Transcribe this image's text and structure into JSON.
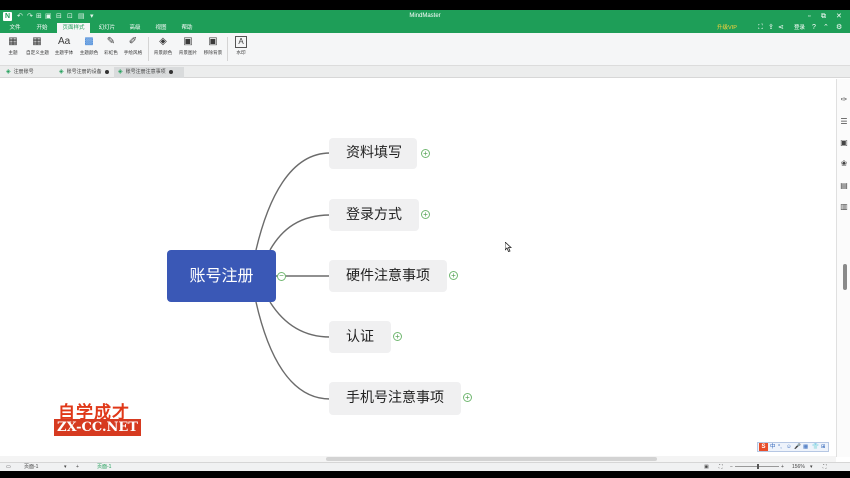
{
  "app": {
    "title": "MindMaster",
    "logo": "N"
  },
  "quick_access": [
    "↶",
    "↷",
    "⊞",
    "▣",
    "⊟",
    "⊡",
    "▤",
    "▾"
  ],
  "window_controls": [
    "▫",
    "⧉",
    "✕"
  ],
  "menu_tabs": [
    {
      "label": "文件"
    },
    {
      "label": "开始"
    },
    {
      "label": "页面样式"
    },
    {
      "label": "幻灯片"
    },
    {
      "label": "高级"
    },
    {
      "label": "视图"
    },
    {
      "label": "帮助"
    }
  ],
  "menu_right": {
    "vip": "升级VIP",
    "login": "登录"
  },
  "ribbon": [
    {
      "label": "主题",
      "icon": "▦",
      "name": "theme"
    },
    {
      "label": "自定义主题",
      "icon": "▦",
      "name": "custom-theme"
    },
    {
      "label": "主题字体",
      "icon": "Aa",
      "name": "theme-font"
    },
    {
      "label": "主题颜色",
      "icon": "▩",
      "name": "theme-color"
    },
    {
      "label": "彩虹色",
      "icon": "✎",
      "name": "rainbow"
    },
    {
      "label": "手绘风格",
      "icon": "✐",
      "name": "hand-drawn"
    },
    {
      "label": "背景颜色",
      "icon": "◈",
      "name": "background-color"
    },
    {
      "label": "背景图片",
      "icon": "▣",
      "name": "background-image"
    },
    {
      "label": "移除背景",
      "icon": "▣",
      "name": "remove-background"
    },
    {
      "label": "水印",
      "icon": "A",
      "name": "watermark"
    }
  ],
  "doc_tabs": [
    {
      "label": "注册账号",
      "active": false,
      "modified": false
    },
    {
      "label": "账号注册的设备",
      "active": false,
      "modified": true
    },
    {
      "label": "账号注册注意事项",
      "active": true,
      "modified": true
    }
  ],
  "mindmap": {
    "central": "账号注册",
    "topics": [
      {
        "label": "资料填写"
      },
      {
        "label": "登录方式"
      },
      {
        "label": "硬件注意事项"
      },
      {
        "label": "认证"
      },
      {
        "label": "手机号注意事项"
      }
    ],
    "central_color": "#3a58b6",
    "branch_color": "#6b6b6b"
  },
  "watermark": {
    "line1": "自学成才",
    "line2": "ZX-CC.NET"
  },
  "ime": {
    "brand": "S",
    "items": [
      "中",
      "°,",
      "☺",
      "🎤",
      "▦",
      "👕",
      "⊞"
    ]
  },
  "status": {
    "page_selector": "页面-1",
    "page_tab": "页面-1",
    "zoom": "156%"
  }
}
